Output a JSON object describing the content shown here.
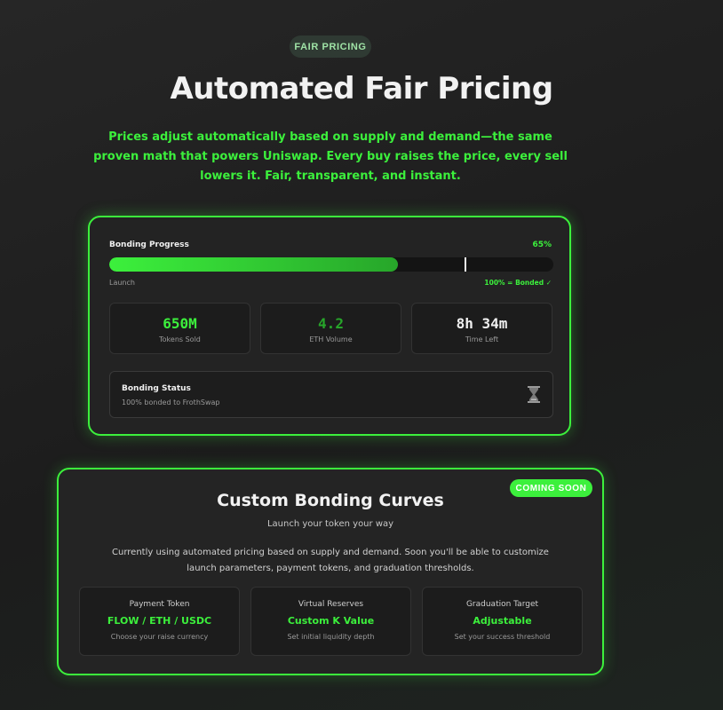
{
  "header": {
    "badge": "FAIR PRICING",
    "title": "Automated Fair Pricing",
    "subtitle": "Prices adjust automatically based on supply and demand—the same proven math that powers Uniswap. Every buy raises the price, every sell lowers it. Fair, transparent, and instant."
  },
  "bonding": {
    "label": "Bonding Progress",
    "percent_label": "65%",
    "progress": 0.65,
    "marker": 0.8,
    "start_label": "Launch",
    "end_label": "100% = Bonded ✓",
    "stats": [
      {
        "value": "650M",
        "label": "Tokens Sold",
        "color": "#3cf03c"
      },
      {
        "value": "4.2",
        "label": "ETH Volume",
        "color": "#27a62a"
      },
      {
        "value": "8h 34m",
        "label": "Time Left",
        "color": "#f0f0f0"
      }
    ],
    "status": {
      "title": "Bonding Status",
      "subtitle": "100% bonded to FrothSwap",
      "icon": "hourglass-icon"
    }
  },
  "curves": {
    "badge": "COMING SOON",
    "title": "Custom Bonding Curves",
    "tagline": "Launch your token your way",
    "description": "Currently using automated pricing based on supply and demand. Soon you'll be able to customize launch parameters, payment tokens, and graduation thresholds.",
    "options": [
      {
        "title": "Payment Token",
        "value": "FLOW / ETH / USDC",
        "subtitle": "Choose your raise currency"
      },
      {
        "title": "Virtual Reserves",
        "value": "Custom K Value",
        "subtitle": "Set initial liquidity depth"
      },
      {
        "title": "Graduation Target",
        "value": "Adjustable",
        "subtitle": "Set your success threshold"
      }
    ]
  },
  "colors": {
    "accent": "#3cf03c",
    "accent_dark": "#27a62a",
    "background": "#1e1e1e"
  }
}
